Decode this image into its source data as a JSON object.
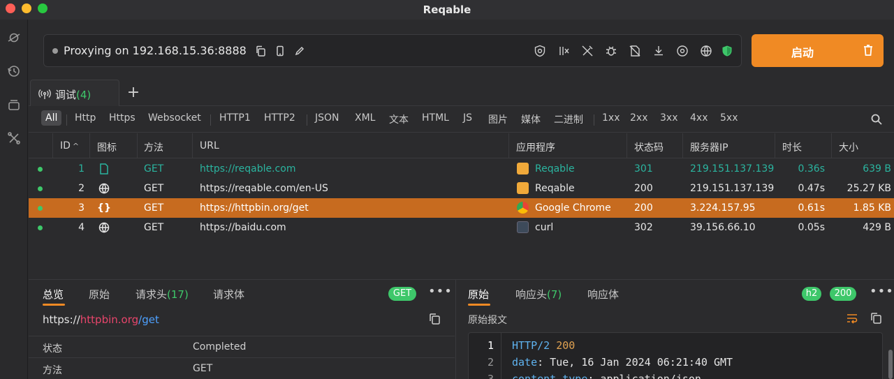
{
  "app": {
    "title": "Reqable"
  },
  "colors": {
    "accent": "#f08a24",
    "success": "#3ec76a",
    "selected_row": "#c76b1f",
    "teal": "#2bb5a0"
  },
  "rail": {
    "icons": [
      "planet-icon",
      "history-icon",
      "stack-icon",
      "tools-icon"
    ]
  },
  "proxy": {
    "status_text": "Proxying on 192.168.15.36:8888",
    "tool_icons": [
      "cert-icon",
      "breakpoint-icon",
      "rewrite-icon",
      "bug-icon",
      "no-cache-icon",
      "download-icon",
      "target-icon",
      "globe-icon",
      "shield-icon"
    ]
  },
  "start_button": {
    "label": "启动"
  },
  "tabs": [
    {
      "label": "调试",
      "count": "(4)"
    }
  ],
  "filters": [
    "All",
    "Http",
    "Https",
    "Websocket",
    "HTTP1",
    "HTTP2",
    "JSON",
    "XML",
    "文本",
    "HTML",
    "JS",
    "图片",
    "媒体",
    "二进制",
    "1xx",
    "2xx",
    "3xx",
    "4xx",
    "5xx"
  ],
  "table": {
    "columns": [
      "ID",
      "图标",
      "方法",
      "URL",
      "应用程序",
      "状态码",
      "服务器IP",
      "时长",
      "大小"
    ],
    "rows": [
      {
        "id": "1",
        "method": "GET",
        "url": "https://reqable.com",
        "app": "Reqable",
        "status": "301",
        "ip": "219.151.137.139",
        "duration": "0.36s",
        "size": "639 B"
      },
      {
        "id": "2",
        "method": "GET",
        "url": "https://reqable.com/en-US",
        "app": "Reqable",
        "status": "200",
        "ip": "219.151.137.139",
        "duration": "0.47s",
        "size": "25.27 KB"
      },
      {
        "id": "3",
        "method": "GET",
        "url": "https://httpbin.org/get",
        "app": "Google Chrome",
        "status": "200",
        "ip": "3.224.157.95",
        "duration": "0.61s",
        "size": "1.85 KB"
      },
      {
        "id": "4",
        "method": "GET",
        "url": "https://baidu.com",
        "app": "curl",
        "status": "302",
        "ip": "39.156.66.10",
        "duration": "0.05s",
        "size": "429 B"
      }
    ]
  },
  "request_panel": {
    "tabs": [
      {
        "label": "总览"
      },
      {
        "label": "原始"
      },
      {
        "label": "请求头",
        "count": "(17)"
      },
      {
        "label": "请求体"
      }
    ],
    "method_badge": "GET",
    "url": {
      "scheme": "https://",
      "host": "httpbin.org",
      "path": "/get"
    },
    "details": [
      {
        "key": "状态",
        "value": "Completed"
      },
      {
        "key": "方法",
        "value": "GET"
      }
    ]
  },
  "response_panel": {
    "tabs": [
      {
        "label": "原始"
      },
      {
        "label": "响应头",
        "count": "(7)"
      },
      {
        "label": "响应体"
      }
    ],
    "protocol_badge": "h2",
    "status_badge": "200",
    "section_label": "原始报文",
    "lines": [
      {
        "n": "1",
        "parts": [
          {
            "t": "HTTP/2",
            "c": "kw"
          },
          {
            "t": " ",
            "c": ""
          },
          {
            "t": "200",
            "c": "num"
          }
        ]
      },
      {
        "n": "2",
        "parts": [
          {
            "t": "date",
            "c": "kw"
          },
          {
            "t": ": Tue, 16 Jan 2024 06:21:40 GMT",
            "c": ""
          }
        ]
      },
      {
        "n": "3",
        "parts": [
          {
            "t": "content-type",
            "c": "kw"
          },
          {
            "t": ": application/json",
            "c": ""
          }
        ]
      }
    ]
  }
}
